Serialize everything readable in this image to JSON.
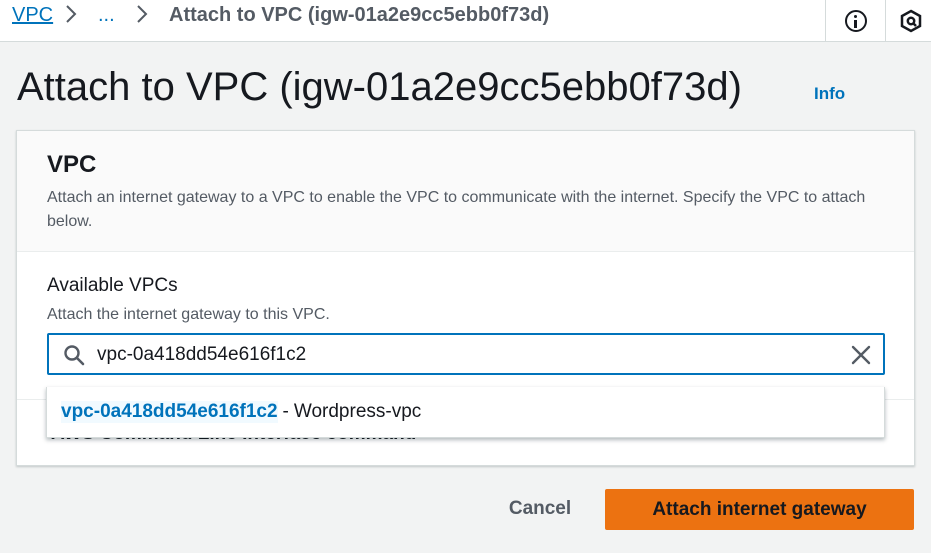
{
  "breadcrumb": {
    "root": "VPC",
    "ellipsis": "...",
    "current": "Attach to VPC (igw-01a2e9cc5ebb0f73d)"
  },
  "header_icons": [
    "info-icon",
    "settings-hexagon-icon"
  ],
  "page": {
    "title": "Attach to VPC (igw-01a2e9cc5ebb0f73d)",
    "info_link": "Info"
  },
  "panel": {
    "title": "VPC",
    "description": "Attach an internet gateway to a VPC to enable the VPC to communicate with the internet. Specify the VPC to attach below.",
    "field_label": "Available VPCs",
    "field_description": "Attach the internet gateway to this VPC.",
    "search_value": "vpc-0a418dd54e616f1c2",
    "collapsed_section_label": "AWS Command Line Interface command"
  },
  "dropdown": {
    "options": [
      {
        "id": "vpc-0a418dd54e616f1c2",
        "separator": "-",
        "name": "Wordpress-vpc"
      }
    ]
  },
  "footer": {
    "cancel_label": "Cancel",
    "attach_label": "Attach internet gateway"
  },
  "colors": {
    "link": "#0073bb",
    "primary_button": "#ec7211",
    "background": "#f2f3f3"
  }
}
